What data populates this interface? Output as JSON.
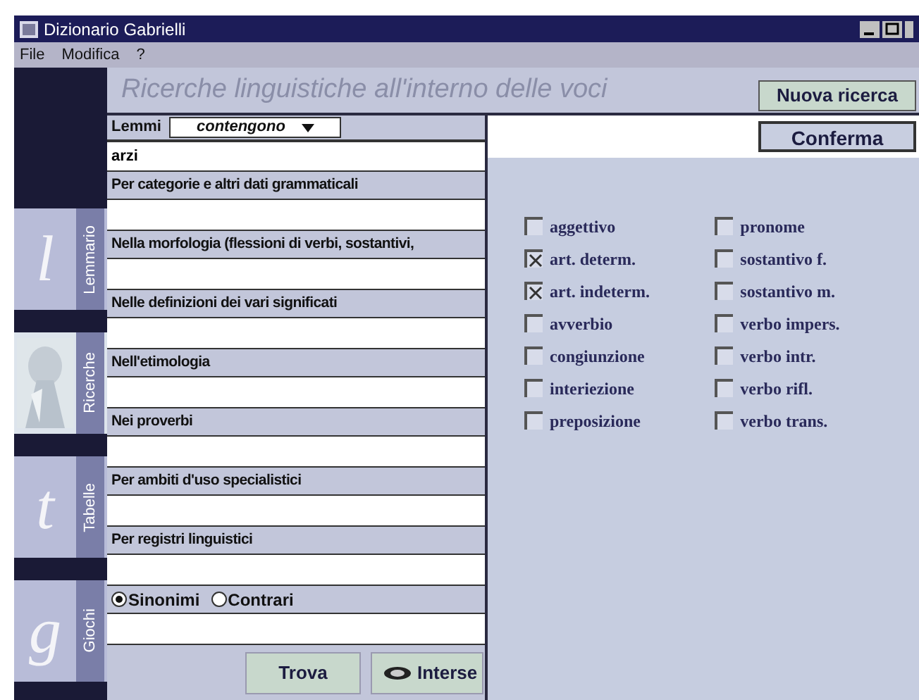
{
  "window": {
    "title": "Dizionario Gabrielli"
  },
  "menu": [
    "File",
    "Modifica",
    "?"
  ],
  "sidebar": {
    "tabs": [
      {
        "label": "Lemmario",
        "letter": "l",
        "selected": false
      },
      {
        "label": "Ricerche",
        "selected": true
      },
      {
        "label": "Tabelle",
        "letter": "t",
        "selected": false
      },
      {
        "label": "Giochi",
        "letter": "g",
        "selected": false
      }
    ]
  },
  "header": {
    "title": "Ricerche linguistiche all'interno delle voci",
    "button": "Nuova ricerca"
  },
  "lemmi": {
    "label": "Lemmi",
    "operator": "contengono",
    "value": "arzi"
  },
  "fields": [
    {
      "kind": "text",
      "label": "Per categorie e altri dati grammaticali"
    },
    {
      "kind": "text",
      "label": "Nella morfologia (flessioni di verbi, sostantivi,"
    },
    {
      "kind": "text",
      "label": "Nelle definizioni dei vari significati"
    },
    {
      "kind": "text",
      "label": "Nell'etimologia"
    },
    {
      "kind": "text",
      "label": "Nei proverbi"
    },
    {
      "kind": "text",
      "label": "Per ambiti d'uso specialistici"
    },
    {
      "kind": "text",
      "label": "Per registri linguistici"
    },
    {
      "kind": "radio",
      "options": [
        {
          "label": "Sinonimi",
          "selected": true
        },
        {
          "label": "Contrari",
          "selected": false
        }
      ]
    }
  ],
  "actions": [
    "Trova",
    "Interse"
  ],
  "confirm": "Conferma",
  "categories": [
    {
      "label": "aggettivo",
      "checked": false
    },
    {
      "label": "art. determ.",
      "checked": true
    },
    {
      "label": "art. indeterm.",
      "checked": true
    },
    {
      "label": "avverbio",
      "checked": false
    },
    {
      "label": "congiunzione",
      "checked": false
    },
    {
      "label": "interiezione",
      "checked": false
    },
    {
      "label": "preposizione",
      "checked": false
    },
    {
      "label": "pronome",
      "checked": false
    },
    {
      "label": "sostantivo f.",
      "checked": false
    },
    {
      "label": "sostantivo m.",
      "checked": false
    },
    {
      "label": "verbo impers.",
      "checked": false
    },
    {
      "label": "verbo intr.",
      "checked": false
    },
    {
      "label": "verbo rifl.",
      "checked": false
    },
    {
      "label": "verbo trans.",
      "checked": false
    }
  ]
}
